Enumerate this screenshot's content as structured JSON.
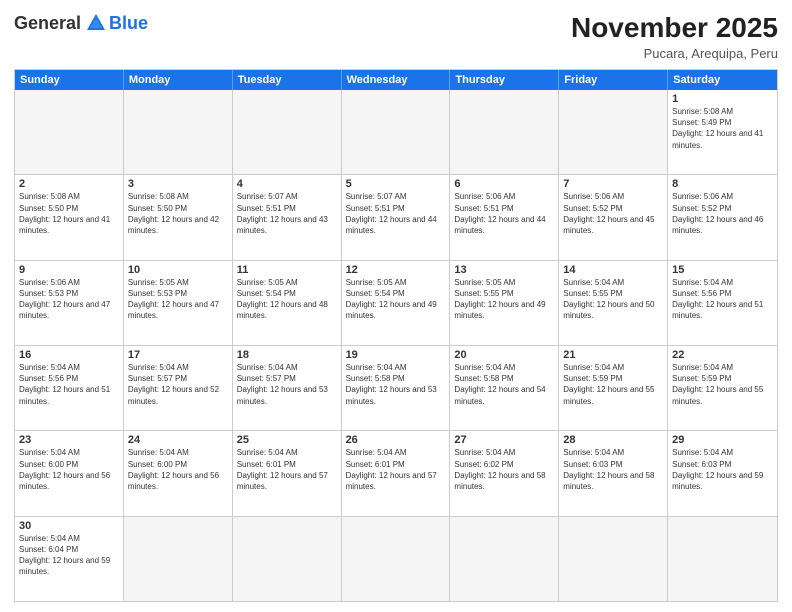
{
  "header": {
    "logo_general": "General",
    "logo_blue": "Blue",
    "month_title": "November 2025",
    "subtitle": "Pucara, Arequipa, Peru"
  },
  "days_of_week": [
    "Sunday",
    "Monday",
    "Tuesday",
    "Wednesday",
    "Thursday",
    "Friday",
    "Saturday"
  ],
  "weeks": [
    [
      {
        "day": "",
        "empty": true
      },
      {
        "day": "",
        "empty": true
      },
      {
        "day": "",
        "empty": true
      },
      {
        "day": "",
        "empty": true
      },
      {
        "day": "",
        "empty": true
      },
      {
        "day": "",
        "empty": true
      },
      {
        "day": "1",
        "sunrise": "Sunrise: 5:08 AM",
        "sunset": "Sunset: 5:49 PM",
        "daylight": "Daylight: 12 hours and 41 minutes."
      }
    ],
    [
      {
        "day": "2",
        "sunrise": "Sunrise: 5:08 AM",
        "sunset": "Sunset: 5:50 PM",
        "daylight": "Daylight: 12 hours and 41 minutes."
      },
      {
        "day": "3",
        "sunrise": "Sunrise: 5:08 AM",
        "sunset": "Sunset: 5:50 PM",
        "daylight": "Daylight: 12 hours and 42 minutes."
      },
      {
        "day": "4",
        "sunrise": "Sunrise: 5:07 AM",
        "sunset": "Sunset: 5:51 PM",
        "daylight": "Daylight: 12 hours and 43 minutes."
      },
      {
        "day": "5",
        "sunrise": "Sunrise: 5:07 AM",
        "sunset": "Sunset: 5:51 PM",
        "daylight": "Daylight: 12 hours and 44 minutes."
      },
      {
        "day": "6",
        "sunrise": "Sunrise: 5:06 AM",
        "sunset": "Sunset: 5:51 PM",
        "daylight": "Daylight: 12 hours and 44 minutes."
      },
      {
        "day": "7",
        "sunrise": "Sunrise: 5:06 AM",
        "sunset": "Sunset: 5:52 PM",
        "daylight": "Daylight: 12 hours and 45 minutes."
      },
      {
        "day": "8",
        "sunrise": "Sunrise: 5:06 AM",
        "sunset": "Sunset: 5:52 PM",
        "daylight": "Daylight: 12 hours and 46 minutes."
      }
    ],
    [
      {
        "day": "9",
        "sunrise": "Sunrise: 5:06 AM",
        "sunset": "Sunset: 5:53 PM",
        "daylight": "Daylight: 12 hours and 47 minutes."
      },
      {
        "day": "10",
        "sunrise": "Sunrise: 5:05 AM",
        "sunset": "Sunset: 5:53 PM",
        "daylight": "Daylight: 12 hours and 47 minutes."
      },
      {
        "day": "11",
        "sunrise": "Sunrise: 5:05 AM",
        "sunset": "Sunset: 5:54 PM",
        "daylight": "Daylight: 12 hours and 48 minutes."
      },
      {
        "day": "12",
        "sunrise": "Sunrise: 5:05 AM",
        "sunset": "Sunset: 5:54 PM",
        "daylight": "Daylight: 12 hours and 49 minutes."
      },
      {
        "day": "13",
        "sunrise": "Sunrise: 5:05 AM",
        "sunset": "Sunset: 5:55 PM",
        "daylight": "Daylight: 12 hours and 49 minutes."
      },
      {
        "day": "14",
        "sunrise": "Sunrise: 5:04 AM",
        "sunset": "Sunset: 5:55 PM",
        "daylight": "Daylight: 12 hours and 50 minutes."
      },
      {
        "day": "15",
        "sunrise": "Sunrise: 5:04 AM",
        "sunset": "Sunset: 5:56 PM",
        "daylight": "Daylight: 12 hours and 51 minutes."
      }
    ],
    [
      {
        "day": "16",
        "sunrise": "Sunrise: 5:04 AM",
        "sunset": "Sunset: 5:56 PM",
        "daylight": "Daylight: 12 hours and 51 minutes."
      },
      {
        "day": "17",
        "sunrise": "Sunrise: 5:04 AM",
        "sunset": "Sunset: 5:57 PM",
        "daylight": "Daylight: 12 hours and 52 minutes."
      },
      {
        "day": "18",
        "sunrise": "Sunrise: 5:04 AM",
        "sunset": "Sunset: 5:57 PM",
        "daylight": "Daylight: 12 hours and 53 minutes."
      },
      {
        "day": "19",
        "sunrise": "Sunrise: 5:04 AM",
        "sunset": "Sunset: 5:58 PM",
        "daylight": "Daylight: 12 hours and 53 minutes."
      },
      {
        "day": "20",
        "sunrise": "Sunrise: 5:04 AM",
        "sunset": "Sunset: 5:58 PM",
        "daylight": "Daylight: 12 hours and 54 minutes."
      },
      {
        "day": "21",
        "sunrise": "Sunrise: 5:04 AM",
        "sunset": "Sunset: 5:59 PM",
        "daylight": "Daylight: 12 hours and 55 minutes."
      },
      {
        "day": "22",
        "sunrise": "Sunrise: 5:04 AM",
        "sunset": "Sunset: 5:59 PM",
        "daylight": "Daylight: 12 hours and 55 minutes."
      }
    ],
    [
      {
        "day": "23",
        "sunrise": "Sunrise: 5:04 AM",
        "sunset": "Sunset: 6:00 PM",
        "daylight": "Daylight: 12 hours and 56 minutes."
      },
      {
        "day": "24",
        "sunrise": "Sunrise: 5:04 AM",
        "sunset": "Sunset: 6:00 PM",
        "daylight": "Daylight: 12 hours and 56 minutes."
      },
      {
        "day": "25",
        "sunrise": "Sunrise: 5:04 AM",
        "sunset": "Sunset: 6:01 PM",
        "daylight": "Daylight: 12 hours and 57 minutes."
      },
      {
        "day": "26",
        "sunrise": "Sunrise: 5:04 AM",
        "sunset": "Sunset: 6:01 PM",
        "daylight": "Daylight: 12 hours and 57 minutes."
      },
      {
        "day": "27",
        "sunrise": "Sunrise: 5:04 AM",
        "sunset": "Sunset: 6:02 PM",
        "daylight": "Daylight: 12 hours and 58 minutes."
      },
      {
        "day": "28",
        "sunrise": "Sunrise: 5:04 AM",
        "sunset": "Sunset: 6:03 PM",
        "daylight": "Daylight: 12 hours and 58 minutes."
      },
      {
        "day": "29",
        "sunrise": "Sunrise: 5:04 AM",
        "sunset": "Sunset: 6:03 PM",
        "daylight": "Daylight: 12 hours and 59 minutes."
      }
    ],
    [
      {
        "day": "30",
        "sunrise": "Sunrise: 5:04 AM",
        "sunset": "Sunset: 6:04 PM",
        "daylight": "Daylight: 12 hours and 59 minutes."
      },
      {
        "day": "",
        "empty": true
      },
      {
        "day": "",
        "empty": true
      },
      {
        "day": "",
        "empty": true
      },
      {
        "day": "",
        "empty": true
      },
      {
        "day": "",
        "empty": true
      },
      {
        "day": "",
        "empty": true
      }
    ]
  ]
}
